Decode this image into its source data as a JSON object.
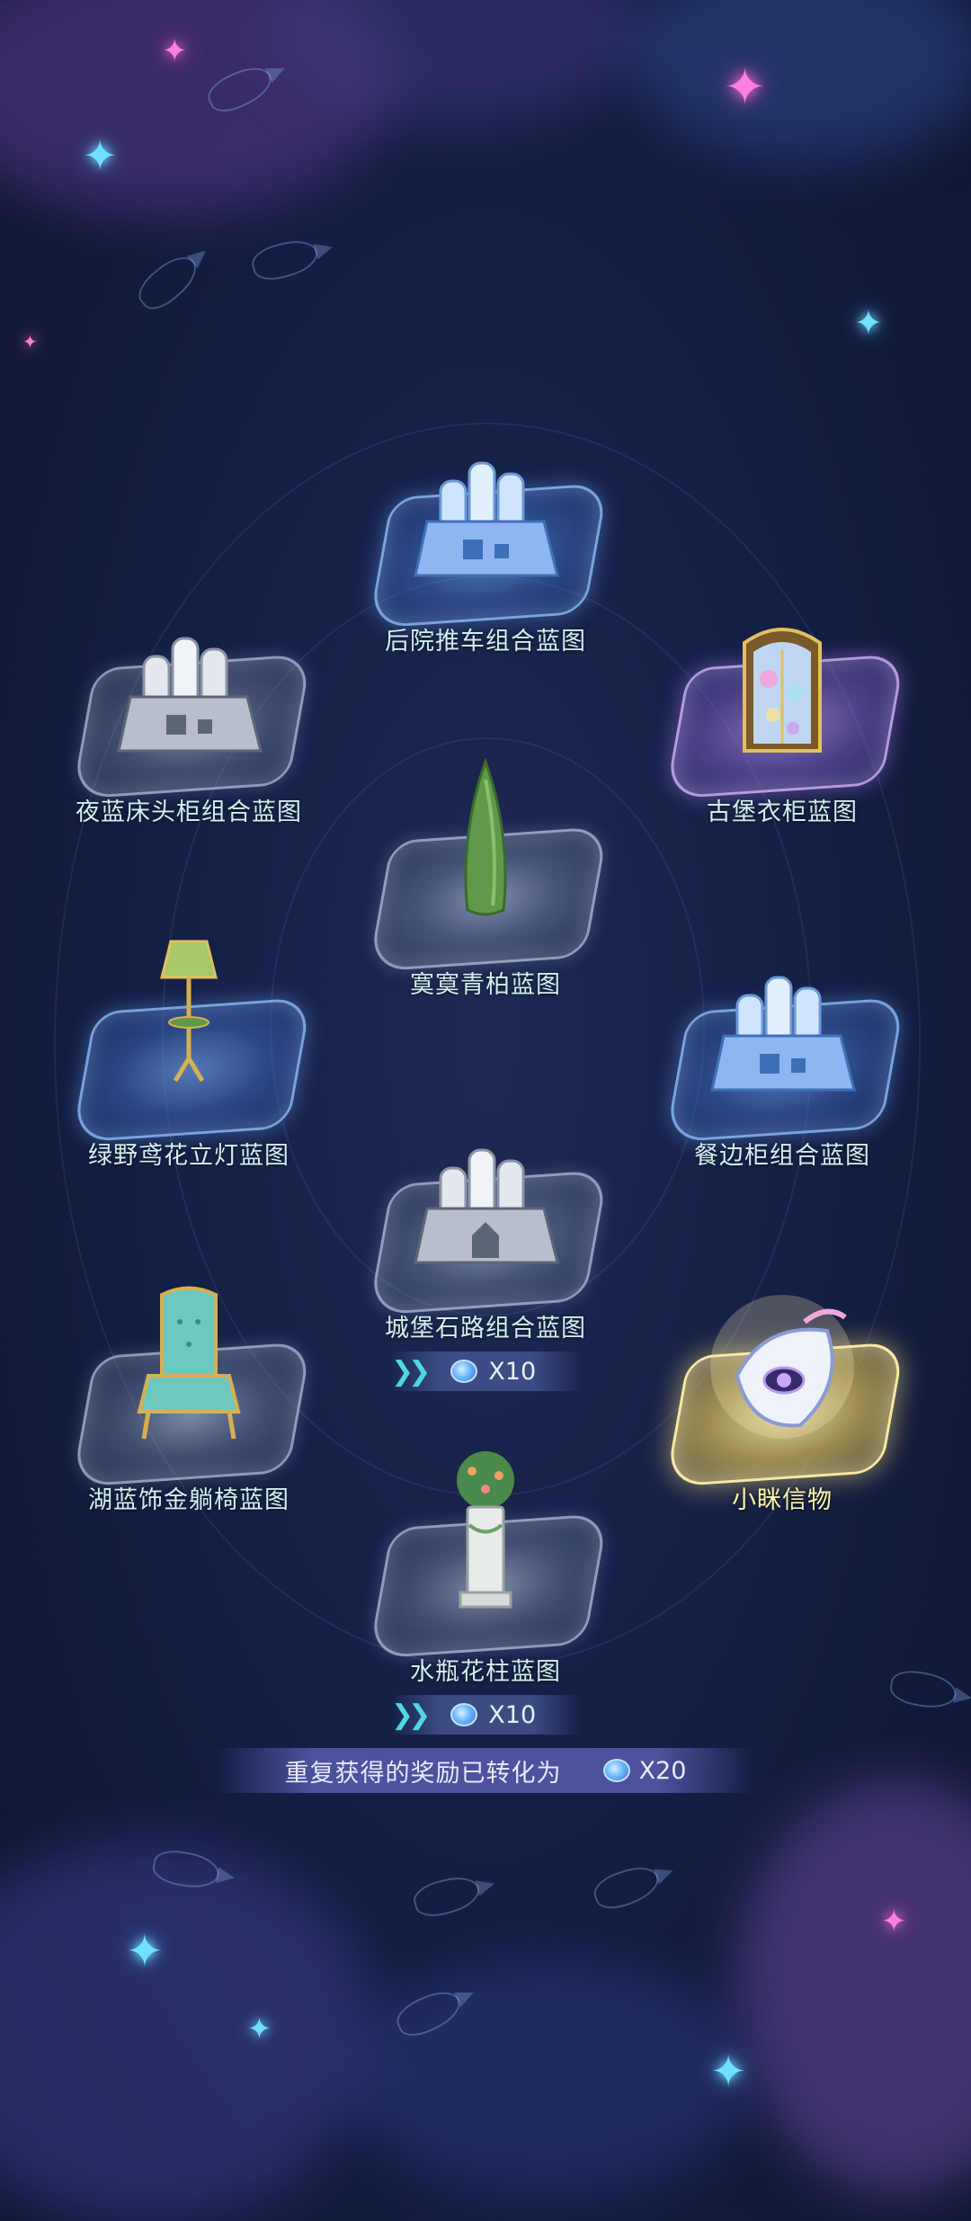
{
  "items": [
    {
      "id": "backyard-cart",
      "label": "后院推车组合蓝图",
      "rarity": "blue",
      "icon": "blueprint-box-icon"
    },
    {
      "id": "night-blue-nightstand",
      "label": "夜蓝床头柜组合蓝图",
      "rarity": "white",
      "icon": "blueprint-box-icon"
    },
    {
      "id": "castle-wardrobe",
      "label": "古堡衣柜蓝图",
      "rarity": "purple",
      "icon": "wardrobe-icon"
    },
    {
      "id": "quiet-cypress",
      "label": "寞寞青柏蓝图",
      "rarity": "white",
      "icon": "cypress-tree-icon"
    },
    {
      "id": "green-floor-lamp",
      "label": "绿野鸢花立灯蓝图",
      "rarity": "blue",
      "icon": "floor-lamp-icon"
    },
    {
      "id": "sideboard",
      "label": "餐边柜组合蓝图",
      "rarity": "blue",
      "icon": "blueprint-box-icon"
    },
    {
      "id": "castle-stone-path",
      "label": "城堡石路组合蓝图",
      "rarity": "white",
      "icon": "blueprint-box-icon",
      "bonus": "X10"
    },
    {
      "id": "lake-blue-chaise",
      "label": "湖蓝饰金躺椅蓝图",
      "rarity": "white",
      "icon": "chaise-chair-icon"
    },
    {
      "id": "xiaomi-token",
      "label": "小眯信物",
      "rarity": "gold",
      "icon": "token-charm-icon"
    },
    {
      "id": "vase-pillar",
      "label": "水瓶花柱蓝图",
      "rarity": "white",
      "icon": "flower-pillar-icon",
      "bonus": "X10"
    }
  ],
  "summary": {
    "text": "重复获得的奖励已转化为",
    "amount": "X20",
    "currency_icon": "blue-gem-icon"
  },
  "colors": {
    "label": "#cfeff2",
    "label_gold": "#fbf3a8",
    "accent_cyan": "#4fd8df"
  }
}
